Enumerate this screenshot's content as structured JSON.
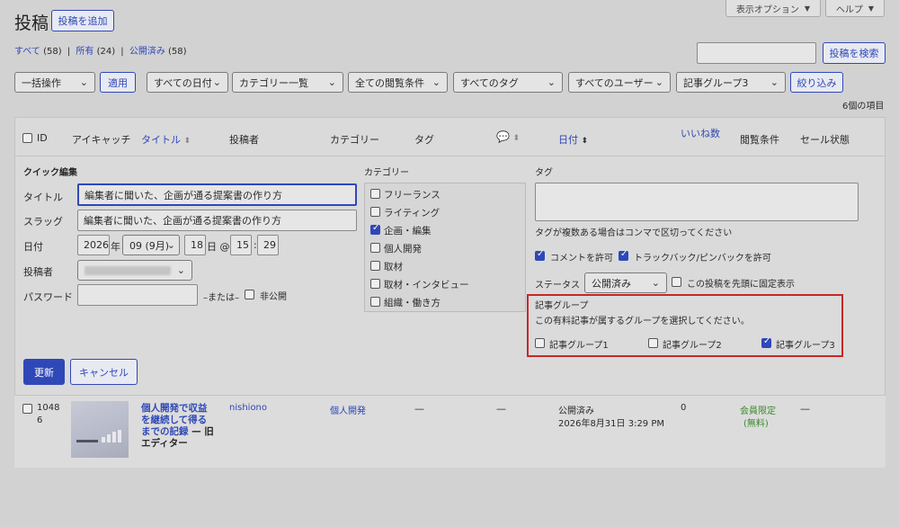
{
  "header": {
    "title": "投稿",
    "add_new": "投稿を追加",
    "screen_options": "表示オプション",
    "help": "ヘルプ"
  },
  "filters_links": {
    "all": "すべて",
    "all_count": "(58)",
    "sep1": "|",
    "mine": "所有",
    "mine_count": "(24)",
    "sep2": "|",
    "published": "公開済み",
    "published_count": "(58)"
  },
  "search": {
    "value": "",
    "button": "投稿を検索"
  },
  "toolbar": {
    "bulk_action": "一括操作",
    "apply": "適用",
    "all_dates": "すべての日付",
    "category": "カテゴリー一覧",
    "viewing_condition": "全ての閲覧条件",
    "tags": "すべてのタグ",
    "users": "すべてのユーザー",
    "article_group": "記事グループ3",
    "filter": "絞り込み",
    "items_count": "6個の項目"
  },
  "columns": {
    "id": "ID",
    "thumbnail": "アイキャッチ",
    "title": "タイトル",
    "author": "投稿者",
    "category": "カテゴリー",
    "tags": "タグ",
    "date": "日付",
    "likes": "いいね数",
    "view_condition": "閲覧条件",
    "sale_status": "セール状態"
  },
  "quick_edit": {
    "heading": "クイック編集",
    "title_label": "タイトル",
    "title_value": "編集者に聞いた、企画が通る提案書の作り方",
    "slug_label": "スラッグ",
    "slug_value": "編集者に聞いた、企画が通る提案書の作り方",
    "date_label": "日付",
    "year": "2026",
    "year_suffix": "年",
    "month": "09 (9月)",
    "day": "18",
    "day_suffix": "日 @",
    "hour": "15",
    "colon": ":",
    "minute": "29",
    "author_label": "投稿者",
    "password_label": "パスワード",
    "or_text": "–または–",
    "private_label": "非公開",
    "category_heading": "カテゴリー",
    "categories": [
      {
        "label": "フリーランス",
        "checked": false
      },
      {
        "label": "ライティング",
        "checked": false
      },
      {
        "label": "企画・編集",
        "checked": true
      },
      {
        "label": "個人開発",
        "checked": false
      },
      {
        "label": "取材",
        "checked": false
      },
      {
        "label": "取材・インタビュー",
        "checked": false
      },
      {
        "label": "組織・働き方",
        "checked": false
      }
    ],
    "tags_heading": "タグ",
    "tags_hint": "タグが複数ある場合はコンマで区切ってください",
    "allow_comments": "コメントを許可",
    "allow_pings": "トラックバック/ピンバックを許可",
    "status_label": "ステータス",
    "status_value": "公開済み",
    "sticky_label": "この投稿を先頭に固定表示",
    "group_heading": "記事グループ",
    "group_desc": "この有料記事が属するグループを選択してください。",
    "groups": [
      {
        "label": "記事グループ1",
        "checked": false
      },
      {
        "label": "記事グループ2",
        "checked": false
      },
      {
        "label": "記事グループ3",
        "checked": true
      }
    ],
    "update": "更新",
    "cancel": "キャンセル"
  },
  "post_row": {
    "id_line1": "1048",
    "id_line2": "6",
    "title_line1": "個人開発で収益",
    "title_line2": "を継続して得る",
    "title_line3": "までの記録",
    "title_suffix": "— 旧",
    "title_suffix2": "エディター",
    "author": "nishiono",
    "category": "個人開発",
    "tags": "—",
    "comments": "—",
    "status": "公開済み",
    "date": "2026年8月31日 3:29 PM",
    "likes": "0",
    "view_line1": "会員限定",
    "view_line2": "(無料)",
    "sale": "—"
  },
  "colors": {
    "accent": "#2f48b8",
    "highlight_box": "#c62828",
    "member_green": "#3a8a2a"
  }
}
